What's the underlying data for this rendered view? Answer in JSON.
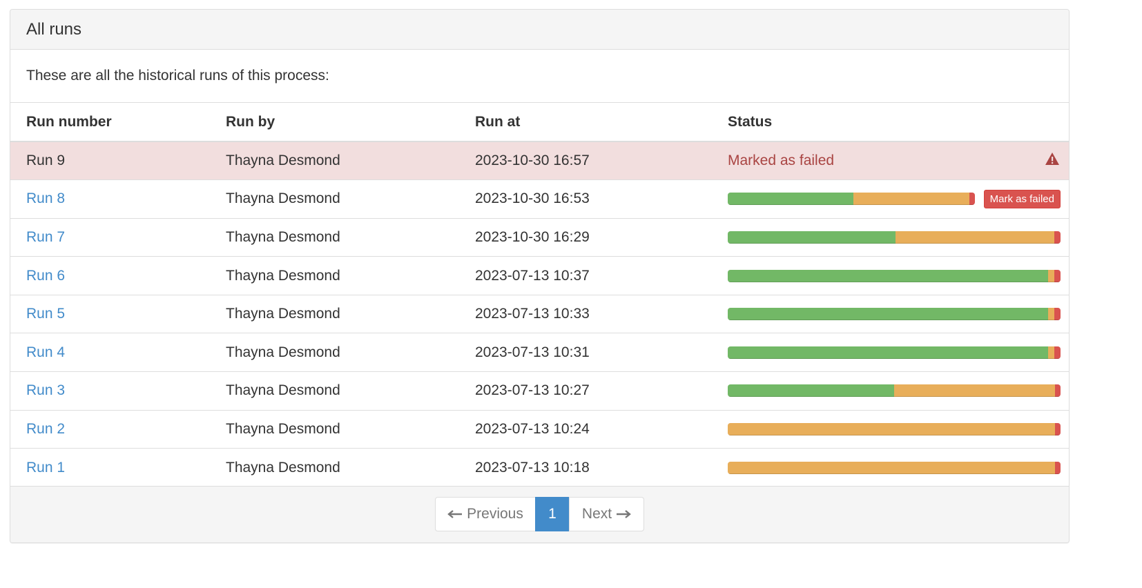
{
  "panel": {
    "title": "All runs",
    "intro": "These are all the historical runs of this process:"
  },
  "table": {
    "headers": {
      "run_number": "Run number",
      "run_by": "Run by",
      "run_at": "Run at",
      "status": "Status"
    },
    "rows": [
      {
        "run": "Run 9",
        "by": "Thayna Desmond",
        "at": "2023-10-30 16:57",
        "link": false,
        "status_text": "Marked as failed",
        "icon": "warning-triangle-icon"
      },
      {
        "run": "Run 8",
        "by": "Thayna Desmond",
        "at": "2023-10-30 16:53",
        "link": true,
        "progress": {
          "success": 0.51,
          "warning": 0.47,
          "danger": 0.02
        },
        "action": "Mark as failed"
      },
      {
        "run": "Run 7",
        "by": "Thayna Desmond",
        "at": "2023-10-30 16:29",
        "link": true,
        "progress": {
          "success": 0.505,
          "warning": 0.477,
          "danger": 0.018
        }
      },
      {
        "run": "Run 6",
        "by": "Thayna Desmond",
        "at": "2023-07-13 10:37",
        "link": true,
        "progress": {
          "success": 0.962,
          "warning": 0.02,
          "danger": 0.018
        }
      },
      {
        "run": "Run 5",
        "by": "Thayna Desmond",
        "at": "2023-07-13 10:33",
        "link": true,
        "progress": {
          "success": 0.962,
          "warning": 0.02,
          "danger": 0.018
        }
      },
      {
        "run": "Run 4",
        "by": "Thayna Desmond",
        "at": "2023-07-13 10:31",
        "link": true,
        "progress": {
          "success": 0.962,
          "warning": 0.02,
          "danger": 0.018
        }
      },
      {
        "run": "Run 3",
        "by": "Thayna Desmond",
        "at": "2023-07-13 10:27",
        "link": true,
        "progress": {
          "success": 0.5,
          "warning": 0.484,
          "danger": 0.016
        }
      },
      {
        "run": "Run 2",
        "by": "Thayna Desmond",
        "at": "2023-07-13 10:24",
        "link": true,
        "progress": {
          "success": 0,
          "warning": 0.984,
          "danger": 0.016
        }
      },
      {
        "run": "Run 1",
        "by": "Thayna Desmond",
        "at": "2023-07-13 10:18",
        "link": true,
        "progress": {
          "success": 0,
          "warning": 0.984,
          "danger": 0.016
        }
      }
    ]
  },
  "pagination": {
    "previous": "Previous",
    "current": "1",
    "next": "Next",
    "prev_icon": "arrow-left-icon",
    "next_icon": "arrow-right-icon"
  },
  "colors": {
    "success": "#72b866",
    "warning": "#e8ae5a",
    "danger": "#d9534f",
    "link": "#428bca",
    "failed_row_bg": "#f2dede"
  }
}
